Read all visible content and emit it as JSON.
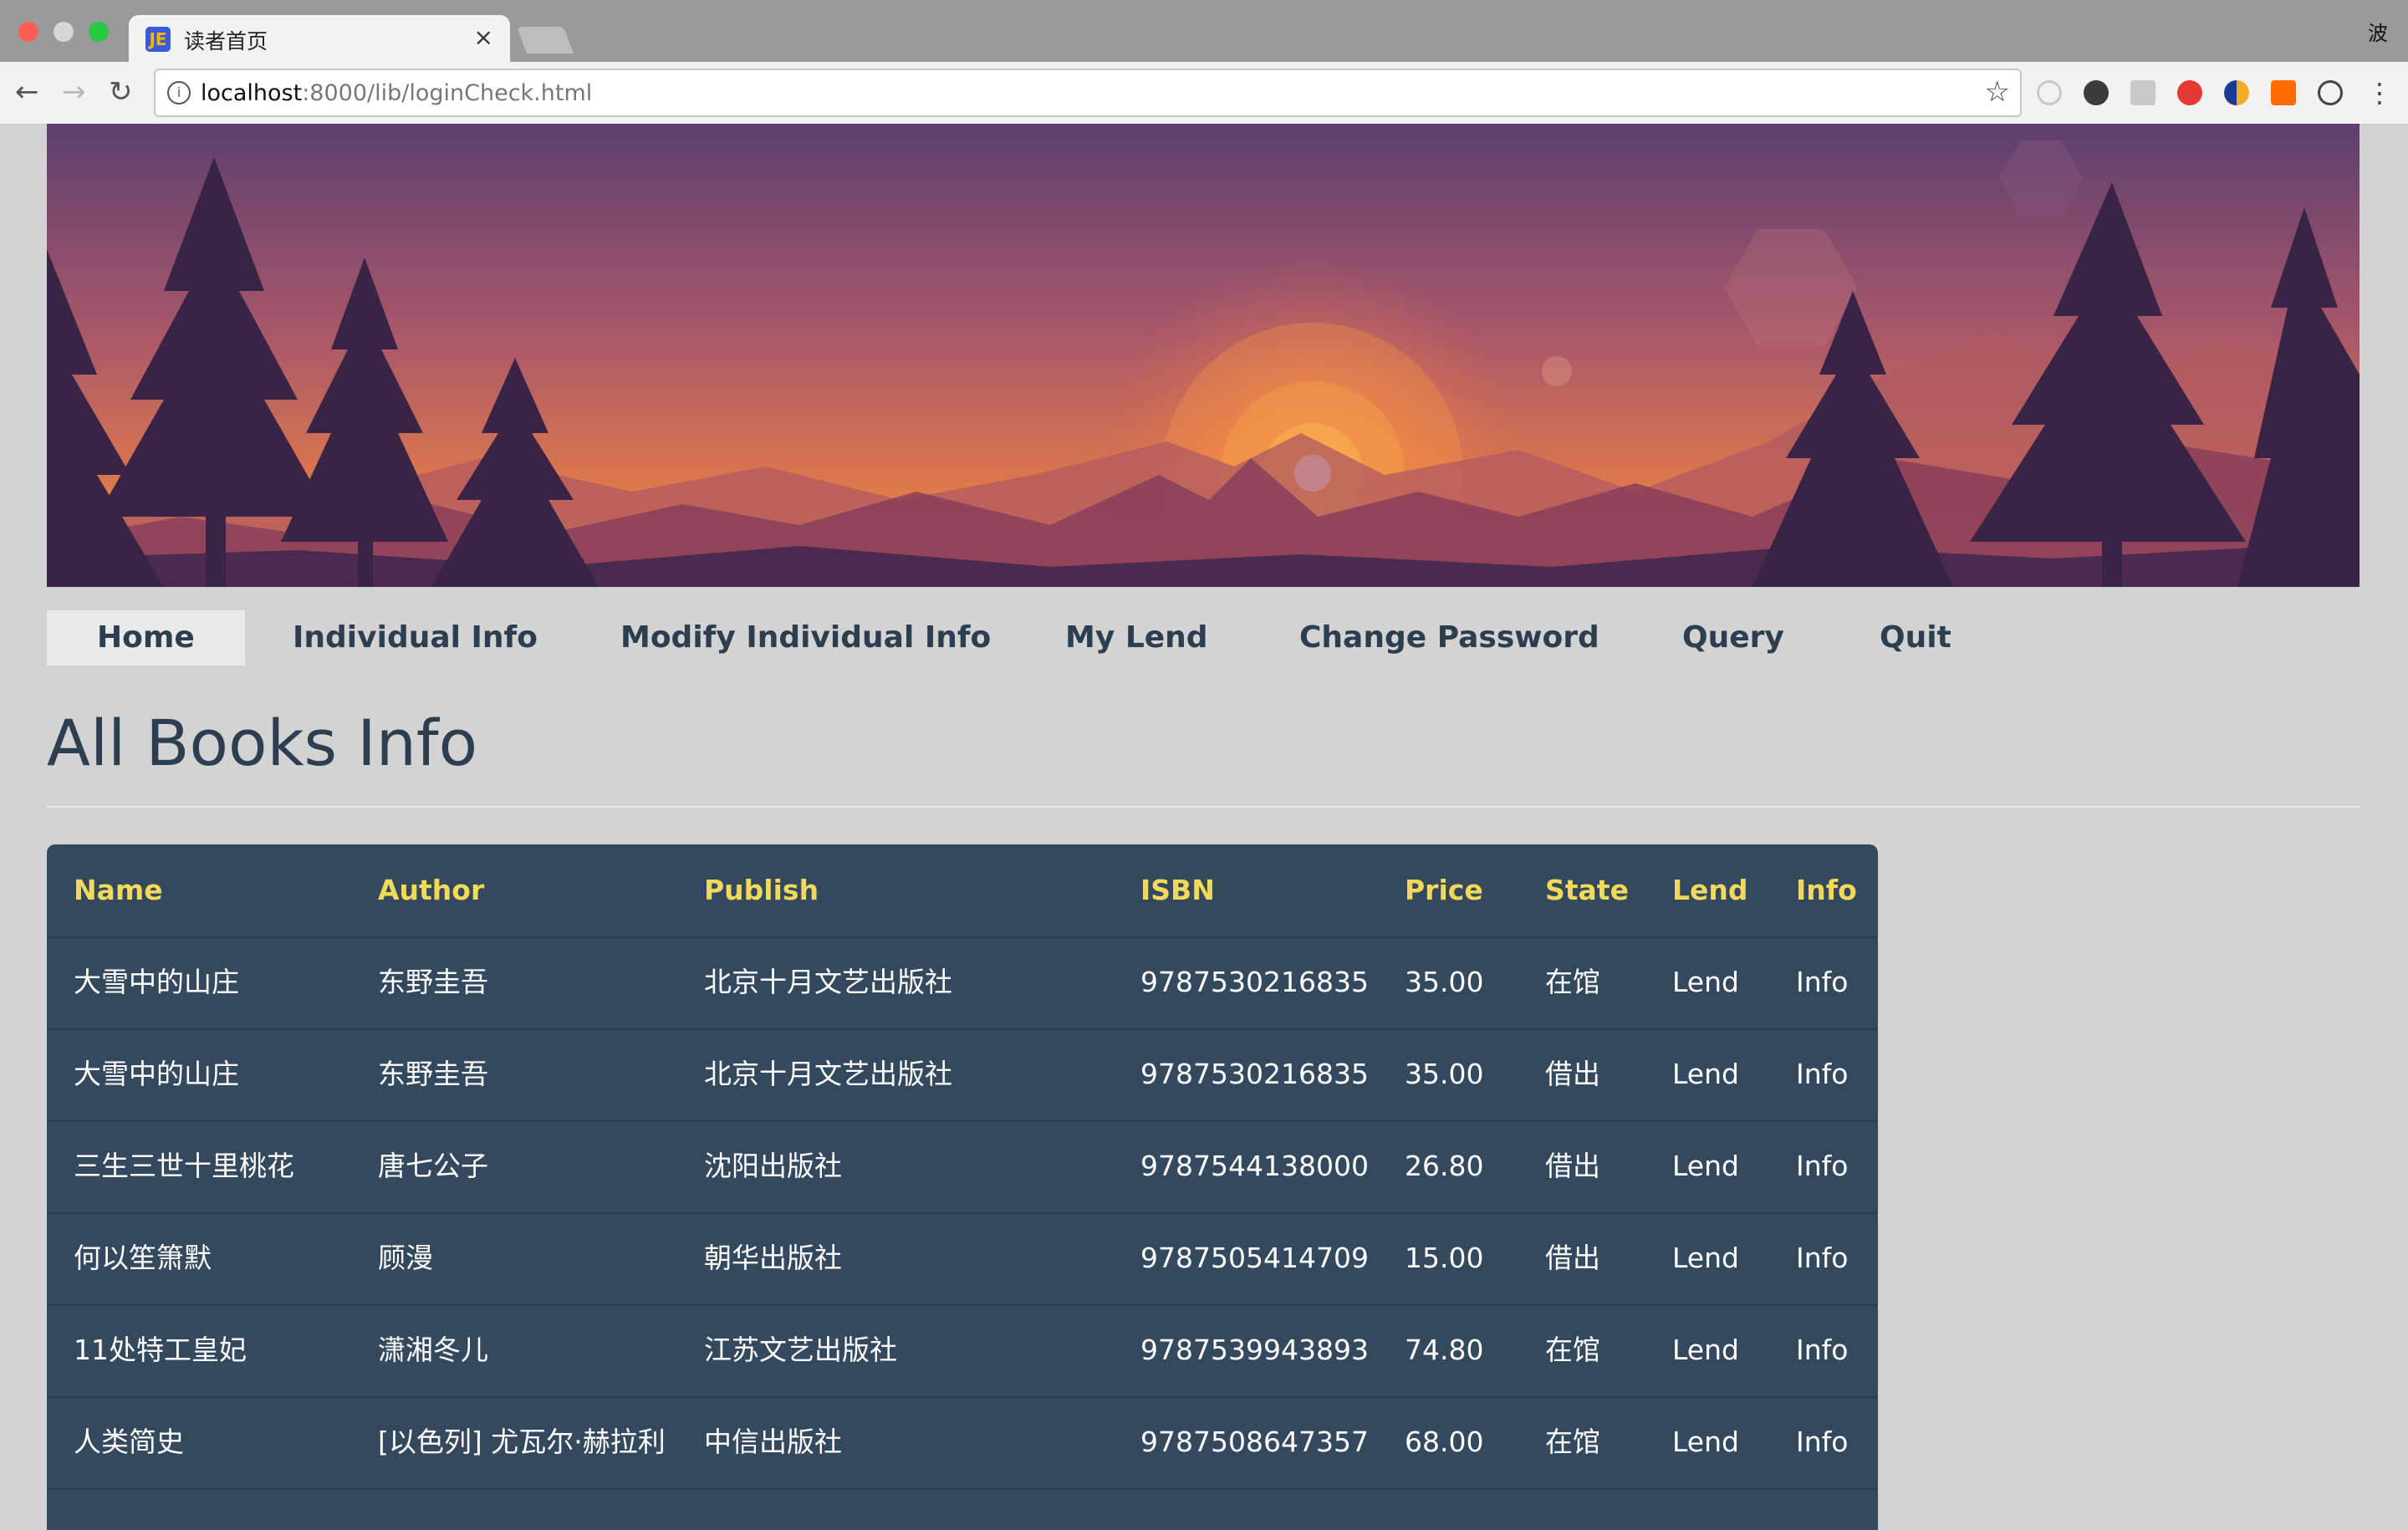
{
  "browser": {
    "tab_title": "读者首页",
    "tab_favicon": "JE",
    "profile_char": "波",
    "url_host": "localhost",
    "url_rest": ":8000/lib/loginCheck.html"
  },
  "nav": {
    "items": [
      "Home",
      "Individual Info",
      "Modify Individual Info",
      "My Lend",
      "Change Password",
      "Query",
      "Quit"
    ],
    "active": "Home"
  },
  "page": {
    "heading": "All Books Info"
  },
  "table": {
    "headers": [
      "Name",
      "Author",
      "Publish",
      "ISBN",
      "Price",
      "State",
      "Lend",
      "Info"
    ],
    "rows": [
      [
        "大雪中的山庄",
        "东野圭吾",
        "北京十月文艺出版社",
        "9787530216835",
        "35.00",
        "在馆",
        "Lend",
        "Info"
      ],
      [
        "大雪中的山庄",
        "东野圭吾",
        "北京十月文艺出版社",
        "9787530216835",
        "35.00",
        "借出",
        "Lend",
        "Info"
      ],
      [
        "三生三世十里桃花",
        "唐七公子",
        "沈阳出版社",
        "9787544138000",
        "26.80",
        "借出",
        "Lend",
        "Info"
      ],
      [
        "何以笙箫默",
        "顾漫",
        "朝华出版社",
        "9787505414709",
        "15.00",
        "借出",
        "Lend",
        "Info"
      ],
      [
        "11处特工皇妃",
        "潇湘冬儿",
        "江苏文艺出版社",
        "9787539943893",
        "74.80",
        "在馆",
        "Lend",
        "Info"
      ],
      [
        "人类简史",
        "[以色列] 尤瓦尔·赫拉利",
        "中信出版社",
        "9787508647357",
        "68.00",
        "在馆",
        "Lend",
        "Info"
      ]
    ]
  },
  "colors": {
    "nav_text": "#2c3e50",
    "table_bg": "#34495e",
    "header_text": "#f1d95a",
    "page_bg": "#d3d3d3"
  },
  "icons": [
    "back-icon",
    "forward-icon",
    "reload-icon",
    "info-icon",
    "star-icon",
    "menu-icon",
    "close-icon"
  ]
}
